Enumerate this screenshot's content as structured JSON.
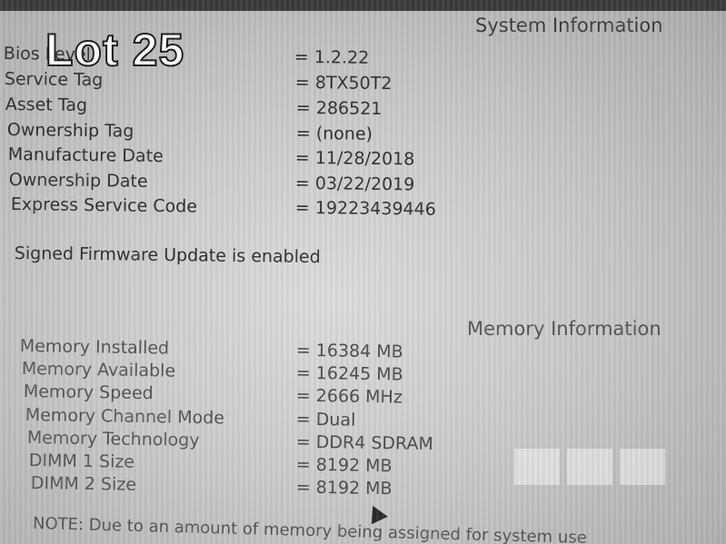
{
  "overlay": {
    "lot_text": "Lot 25"
  },
  "system": {
    "title": "System Information",
    "rows": [
      {
        "label": "Bios Level",
        "value": "= 1.2.22"
      },
      {
        "label": "Service Tag",
        "value": "= 8TX50T2"
      },
      {
        "label": "Asset Tag",
        "value": "= 286521"
      },
      {
        "label": "Ownership Tag",
        "value": "= (none)"
      },
      {
        "label": "Manufacture Date",
        "value": "= 11/28/2018"
      },
      {
        "label": "Ownership Date",
        "value": "= 03/22/2019"
      },
      {
        "label": "Express Service Code",
        "value": "= 19223439446"
      }
    ],
    "firmware_status": "Signed Firmware Update is enabled"
  },
  "memory": {
    "title": "Memory Information",
    "rows": [
      {
        "label": "Memory Installed",
        "value": "= 16384 MB"
      },
      {
        "label": "Memory Available",
        "value": "= 16245 MB"
      },
      {
        "label": "Memory Speed",
        "value": "= 2666 MHz"
      },
      {
        "label": "Memory Channel Mode",
        "value": "= Dual"
      },
      {
        "label": "Memory Technology",
        "value": "= DDR4 SDRAM"
      },
      {
        "label": "DIMM 1 Size",
        "value": "= 8192 MB"
      },
      {
        "label": "DIMM 2 Size",
        "value": "= 8192 MB"
      }
    ],
    "note": "NOTE: Due to an amount of memory being assigned for system use"
  },
  "colors": {
    "screen": "#c9c9c9",
    "text": "#2e2e2e",
    "overlay_text": "#ffffff"
  },
  "icons": [
    "mouse-cursor-icon"
  ]
}
